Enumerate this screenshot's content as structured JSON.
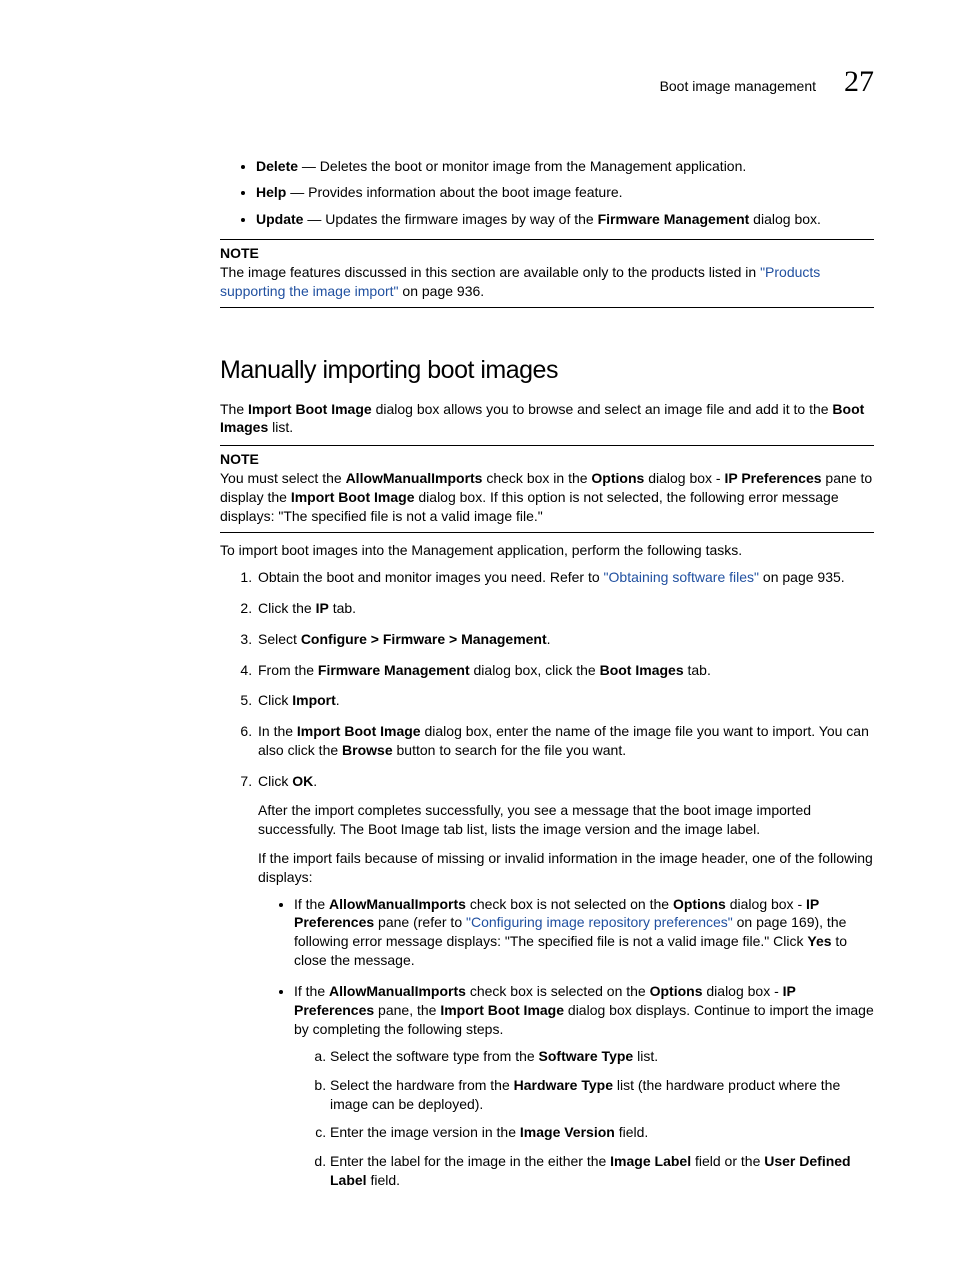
{
  "header": {
    "title": "Boot image management",
    "chapter_number": "27"
  },
  "bullets": {
    "delete_label": "Delete",
    "delete_text": " — Deletes the boot or monitor image from the Management application.",
    "help_label": "Help",
    "help_text": " — Provides information about the boot image feature.",
    "update_label": "Update",
    "update_text_pre": " — Updates the firmware images by way of the ",
    "update_bold": "Firmware Management",
    "update_text_post": " dialog box."
  },
  "note1": {
    "label": "NOTE",
    "text_pre": "The image features discussed in this section are available only to the products listed in ",
    "link": "\"Products supporting the image import\"",
    "text_post": " on page 936."
  },
  "section_heading": "Manually importing boot images",
  "intro": {
    "pre": "The ",
    "b1": "Import Boot Image",
    "mid": " dialog box allows you to browse and select an image file and add it to the ",
    "b2": "Boot Images",
    "post": " list."
  },
  "note2": {
    "label": "NOTE",
    "p1_a": "You must select the ",
    "p1_b1": "AllowManualImports",
    "p1_c": " check box in the ",
    "p1_b2": "Options",
    "p1_d": " dialog box - ",
    "p1_b3": "IP Preferences",
    "p1_e": " pane to display the ",
    "p1_b4": "Import Boot Image",
    "p1_f": " dialog box. If this option is not selected, the following error message displays: \"The specified file is not a valid image file.\""
  },
  "lead_in": "To import boot images into the Management application, perform the following tasks.",
  "steps": {
    "s1_pre": "Obtain the boot and monitor images you need. Refer to ",
    "s1_link": "\"Obtaining software files\"",
    "s1_post": " on page 935.",
    "s2_pre": "Click the ",
    "s2_b": "IP",
    "s2_post": " tab.",
    "s3_pre": "Select ",
    "s3_b": "Configure > Firmware > Management",
    "s3_post": ".",
    "s4_pre": "From the ",
    "s4_b1": "Firmware Management",
    "s4_mid": " dialog box, click the ",
    "s4_b2": "Boot Images",
    "s4_post": " tab.",
    "s5_pre": "Click ",
    "s5_b": "Import",
    "s5_post": ".",
    "s6_pre": "In the ",
    "s6_b1": "Import Boot Image",
    "s6_mid": " dialog box, enter the name of the image file you want to import. You can also click the ",
    "s6_b2": "Browse",
    "s6_post": " button to search for the file you want.",
    "s7_pre": "Click ",
    "s7_b": "OK",
    "s7_post": ".",
    "s7_p1": "After the import completes successfully, you see a message that the boot image imported successfully. The Boot Image tab list, lists the image version and the image label.",
    "s7_p2": "If the import fails because of missing or invalid information in the image header, one of the following displays:"
  },
  "sub": {
    "a_pre": "If the ",
    "a_b1": "AllowManualImports",
    "a_mid1": " check box is not selected on the ",
    "a_b2": "Options",
    "a_mid2": " dialog box - ",
    "a_b3": "IP Preferences",
    "a_mid3": " pane (refer to ",
    "a_link": "\"Configuring image repository preferences\"",
    "a_mid4": " on page 169), the following error message displays: \"The specified file is not a valid image file.\" Click ",
    "a_b4": "Yes",
    "a_post": " to close the message.",
    "b_pre": "If the ",
    "b_b1": "AllowManualImports",
    "b_mid1": " check box is selected on the ",
    "b_b2": "Options",
    "b_mid2": " dialog box - ",
    "b_b3": "IP Preferences",
    "b_mid3": " pane, the ",
    "b_b4": "Import Boot Image",
    "b_post": " dialog box displays. Continue to import the image by completing the following steps."
  },
  "alpha": {
    "a_pre": "Select the software type from the ",
    "a_b": "Software Type",
    "a_post": " list.",
    "b_pre": "Select the hardware from the ",
    "b_b": "Hardware Type",
    "b_post": " list (the hardware product where the image can be deployed).",
    "c_pre": "Enter the image version in the ",
    "c_b": "Image Version",
    "c_post": " field.",
    "d_pre": "Enter the label for the image in the either the ",
    "d_b1": "Image Label",
    "d_mid": " field or the ",
    "d_b2": "User Defined Label",
    "d_post": " field."
  }
}
